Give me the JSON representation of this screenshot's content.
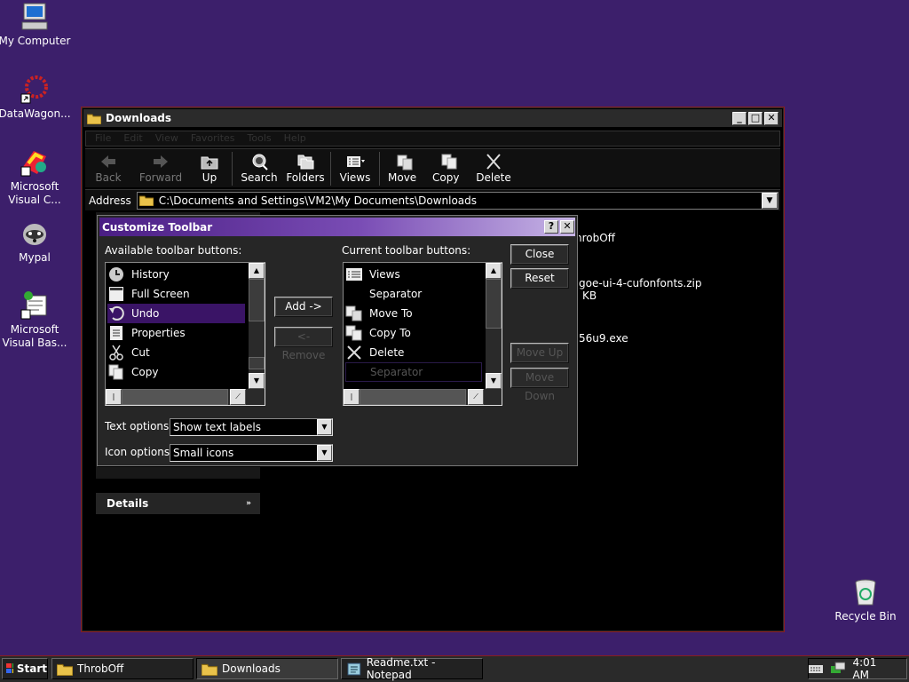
{
  "desktop": {
    "icons": [
      {
        "label": "My Computer",
        "icon": "computer-icon"
      },
      {
        "label": "DataWagon...",
        "icon": "datawagon-icon"
      },
      {
        "label": "Microsoft Visual C...",
        "icon": "visual-c-icon"
      },
      {
        "label": "Mypal",
        "icon": "raccoon-icon"
      },
      {
        "label": "Microsoft Visual Bas...",
        "icon": "visual-basic-icon"
      },
      {
        "label": "Recycle Bin",
        "icon": "recycle-bin-icon"
      }
    ]
  },
  "explorer": {
    "title": "Downloads",
    "toolbar": {
      "back": "Back",
      "forward": "Forward",
      "up": "Up",
      "search": "Search",
      "folders": "Folders",
      "views": "Views",
      "move": "Move ...",
      "copy": "Copy ...",
      "delete": "Delete"
    },
    "address": {
      "label": "Address",
      "value": "C:\\Documents and Settings\\VM2\\My Documents\\Downloads"
    },
    "sidebar": {
      "details_title": "Details"
    },
    "files": [
      "hrobOff",
      "goe-ui-4-cufonfonts.zip",
      "KB",
      "56u9.exe"
    ]
  },
  "dialog": {
    "title": "Customize Toolbar",
    "available_label": "Available toolbar buttons:",
    "current_label": "Current toolbar buttons:",
    "available_items": [
      {
        "label": "History",
        "icon": "history-icon"
      },
      {
        "label": "Full Screen",
        "icon": "full-screen-icon"
      },
      {
        "label": "Undo",
        "icon": "undo-icon"
      },
      {
        "label": "Properties",
        "icon": "properties-icon"
      },
      {
        "label": "Cut",
        "icon": "cut-icon"
      },
      {
        "label": "Copy",
        "icon": "copy-icon"
      }
    ],
    "current_items": [
      {
        "label": "Views",
        "icon": "views-icon"
      },
      {
        "label": "Separator",
        "icon": ""
      },
      {
        "label": "Move To",
        "icon": "move-to-icon"
      },
      {
        "label": "Copy To",
        "icon": "copy-to-icon"
      },
      {
        "label": "Delete",
        "icon": "delete-icon"
      },
      {
        "label": "Separator",
        "icon": ""
      }
    ],
    "buttons": {
      "add": "Add ->",
      "remove": "<- Remove",
      "close": "Close",
      "reset": "Reset",
      "move_up": "Move Up",
      "move_down": "Move Down"
    },
    "text_options": {
      "label": "Text options:",
      "value": "Show text labels"
    },
    "icon_options": {
      "label": "Icon options:",
      "value": "Small icons"
    }
  },
  "taskbar": {
    "start": "Start",
    "tasks": [
      "ThrobOff",
      "Downloads",
      "Readme.txt - Notepad"
    ],
    "clock": "4:01 AM"
  }
}
